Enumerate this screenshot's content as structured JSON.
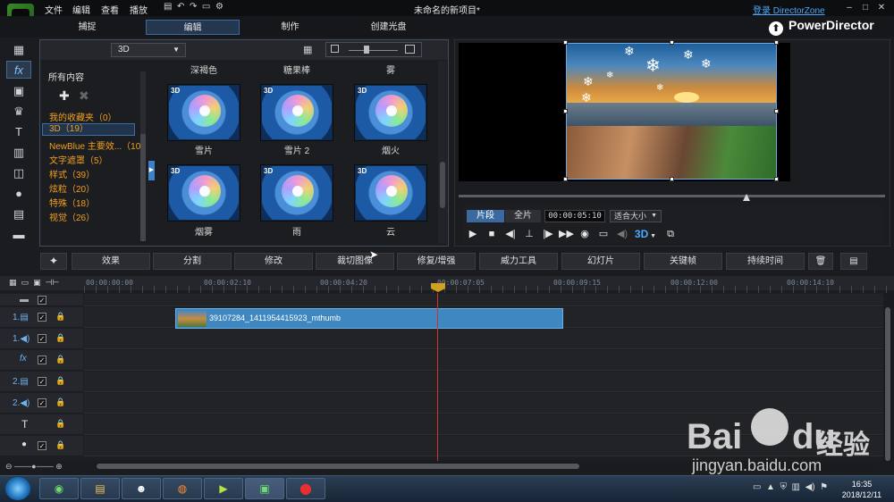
{
  "menu": [
    "文件",
    "编辑",
    "查看",
    "播放"
  ],
  "project_title": "未命名的新项目*",
  "login_link": "登录 DirectorZone",
  "modes": [
    "捕捉",
    "编辑",
    "制作",
    "创建光盘"
  ],
  "brand": "PowerDirector",
  "library": {
    "category": "3D",
    "all_content": "所有内容",
    "categories": [
      "我的收藏夹（0）",
      "3D（19）",
      "NewBlue 主要效...（10）",
      "文字遮罩（5）",
      "样式（39）",
      "炫粒（20）",
      "特殊（18）",
      "视觉（26）"
    ],
    "top_labels": [
      "深褐色",
      "糖果棒",
      "雾"
    ],
    "thumb_tag": "3D",
    "thumbs": [
      "雪片",
      "雪片 2",
      "烟火",
      "烟雾",
      "雨",
      "云"
    ]
  },
  "preview": {
    "segment_tab": "片段",
    "full_tab": "全片",
    "timecode": "00:00:05:10",
    "fit_option": "适合大小",
    "mode_3d": "3D"
  },
  "toolbar": [
    "效果",
    "分割",
    "修改",
    "裁切图像",
    "修复/增强",
    "威力工具",
    "幻灯片",
    "关键帧",
    "持续时间"
  ],
  "timeline": {
    "ticks": [
      "00:00:00:00",
      "00:00:02:10",
      "00:00:04:20",
      "00:00:07:05",
      "00:00:09:15",
      "00:00:12:00",
      "00:00:14:10"
    ],
    "clip_name": "39107284_1411954415923_mthumb",
    "track_labels": [
      "1.",
      "1.",
      "fx",
      "2.",
      "2.",
      "T"
    ]
  },
  "taskbar": {
    "time": "16:35",
    "date": "2018/12/11"
  },
  "watermark": {
    "brand": "Bai",
    "brand2": "du",
    "cn": "经验",
    "url": "jingyan.baidu.com"
  }
}
